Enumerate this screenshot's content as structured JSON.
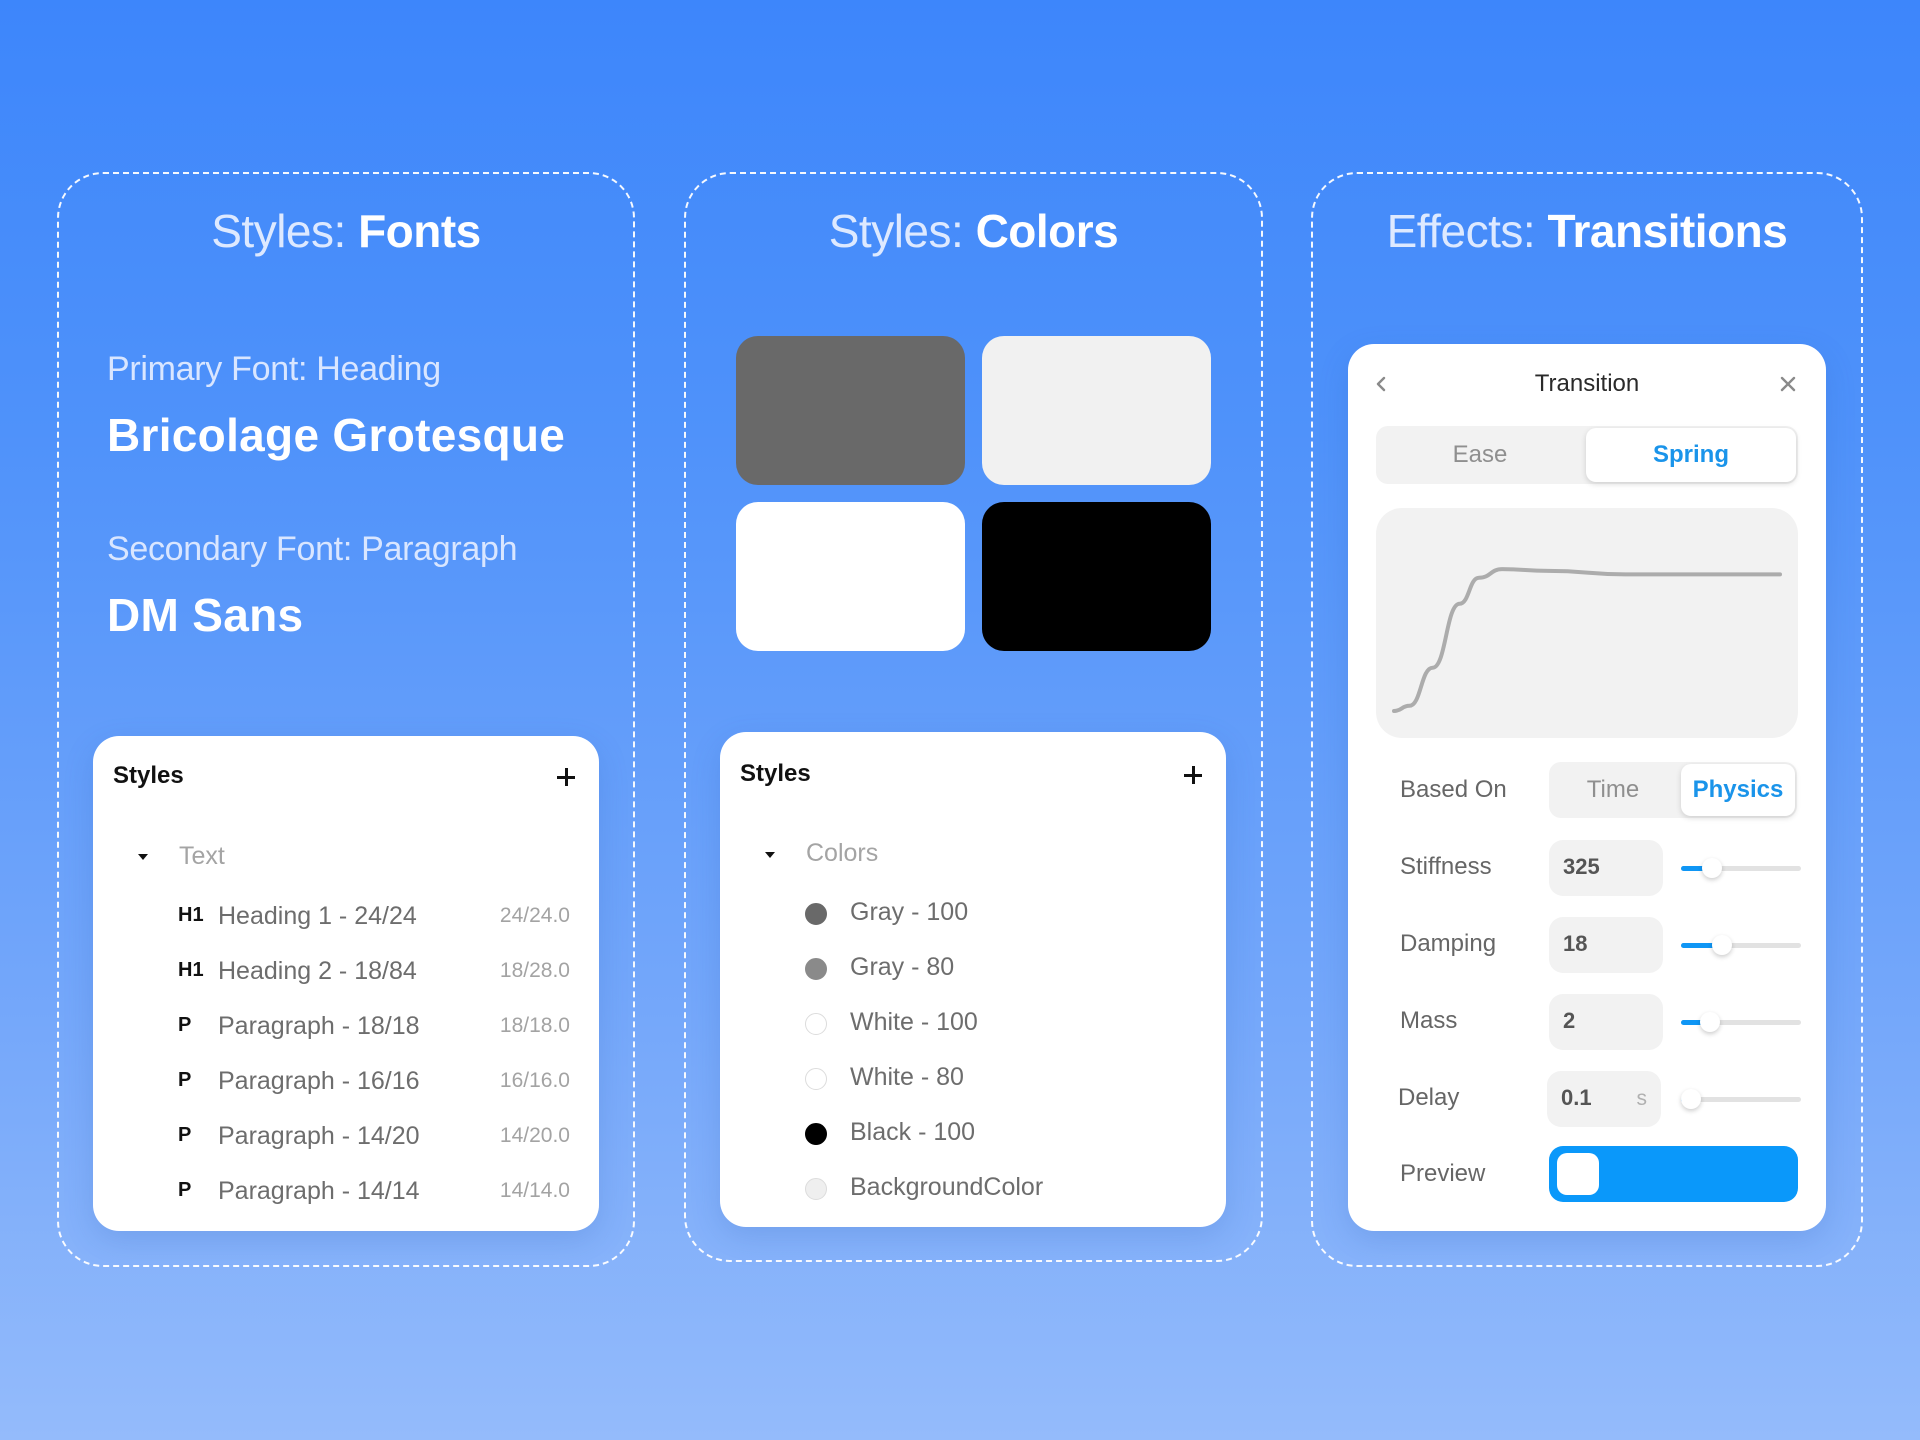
{
  "fonts_section": {
    "title_light": "Styles:",
    "title_bold": "Fonts",
    "primary_label": "Primary Font: Heading",
    "primary_font": "Bricolage Grotesque",
    "secondary_label": "Secondary Font: Paragraph",
    "secondary_font": "DM Sans",
    "panel": {
      "title": "Styles",
      "add_icon": "plus-icon",
      "group": "Text",
      "items": [
        {
          "tag": "H1",
          "name": "Heading 1 - 24/24",
          "meta": "24/24.0"
        },
        {
          "tag": "H1",
          "name": "Heading 2 - 18/84",
          "meta": "18/28.0"
        },
        {
          "tag": "P",
          "name": "Paragraph - 18/18",
          "meta": "18/18.0"
        },
        {
          "tag": "P",
          "name": "Paragraph - 16/16",
          "meta": "16/16.0"
        },
        {
          "tag": "P",
          "name": "Paragraph - 14/20",
          "meta": "14/20.0"
        },
        {
          "tag": "P",
          "name": "Paragraph - 14/14",
          "meta": "14/14.0"
        }
      ]
    }
  },
  "colors_section": {
    "title_light": "Styles:",
    "title_bold": "Colors",
    "swatches": [
      {
        "name": "Gray - 100",
        "hex": "#696969"
      },
      {
        "name": "BackgroundColor",
        "hex": "#f1f1f1"
      },
      {
        "name": "White - 100",
        "hex": "#ffffff"
      },
      {
        "name": "Black - 100",
        "hex": "#000000"
      }
    ],
    "panel": {
      "title": "Styles",
      "add_icon": "plus-icon",
      "group": "Colors",
      "items": [
        {
          "name": "Gray - 100",
          "hex": "#696969",
          "border": "#696969"
        },
        {
          "name": "Gray - 80",
          "hex": "#8a8a8a",
          "border": "#8a8a8a"
        },
        {
          "name": "White - 100",
          "hex": "#ffffff",
          "border": "#dcdcdc"
        },
        {
          "name": "White - 80",
          "hex": "#ffffff",
          "border": "#dcdcdc"
        },
        {
          "name": "Black - 100",
          "hex": "#000000",
          "border": "#000000"
        },
        {
          "name": "BackgroundColor",
          "hex": "#efefef",
          "border": "#dcdcdc"
        }
      ]
    }
  },
  "transitions_section": {
    "title_light": "Effects:",
    "title_bold": "Transitions",
    "panel": {
      "title": "Transition",
      "back_icon": "chevron-left-icon",
      "close_icon": "close-icon",
      "type_tabs": [
        {
          "label": "Ease",
          "active": false
        },
        {
          "label": "Spring",
          "active": true
        }
      ],
      "curve": {
        "type": "spring-response",
        "points": [
          [
            0,
            0
          ],
          [
            0.04,
            0.03
          ],
          [
            0.1,
            0.25
          ],
          [
            0.17,
            0.62
          ],
          [
            0.22,
            0.77
          ],
          [
            0.28,
            0.82
          ],
          [
            0.4,
            0.81
          ],
          [
            0.6,
            0.79
          ],
          [
            1,
            0.79
          ]
        ]
      },
      "based_on": {
        "label": "Based On",
        "options": [
          {
            "label": "Time",
            "active": false
          },
          {
            "label": "Physics",
            "active": true
          }
        ]
      },
      "properties": [
        {
          "label": "Stiffness",
          "value": "325",
          "unit": "",
          "slider": 0.26
        },
        {
          "label": "Damping",
          "value": "18",
          "unit": "",
          "slider": 0.34
        },
        {
          "label": "Mass",
          "value": "2",
          "unit": "",
          "slider": 0.24
        },
        {
          "label": "Delay",
          "value": "0.1",
          "unit": "s",
          "slider": 0.08
        }
      ],
      "preview_label": "Preview",
      "accent": "#0a98fa"
    }
  }
}
